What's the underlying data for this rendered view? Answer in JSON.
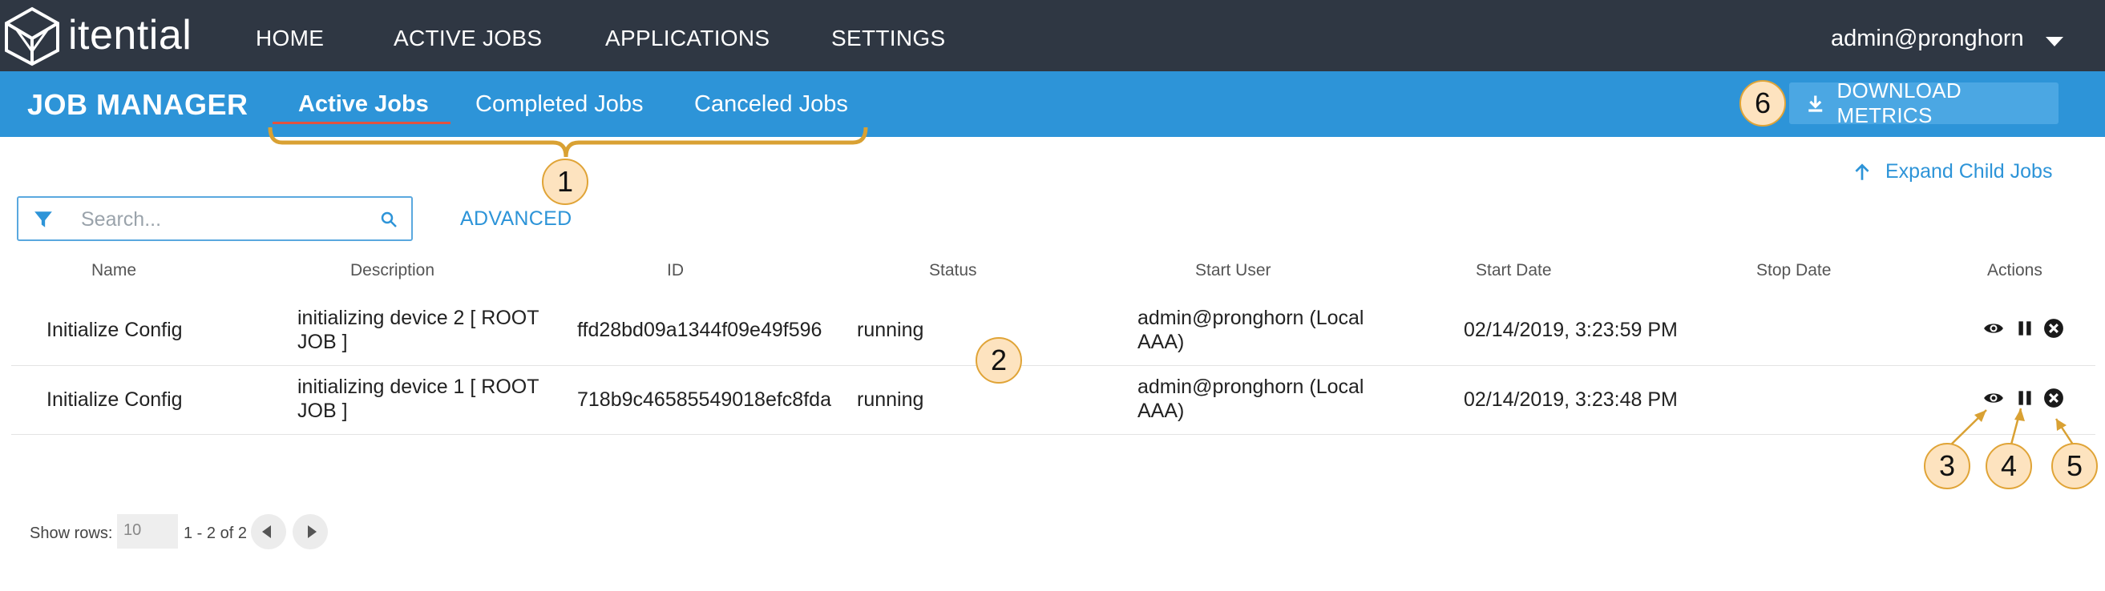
{
  "topbar": {
    "brand": "itential",
    "nav": [
      "HOME",
      "ACTIVE JOBS",
      "APPLICATIONS",
      "SETTINGS"
    ],
    "user": "admin@pronghorn"
  },
  "subbar": {
    "title": "JOB MANAGER",
    "tabs": [
      "Active Jobs",
      "Completed Jobs",
      "Canceled Jobs"
    ],
    "active_tab": "Active Jobs",
    "download_label": "DOWNLOAD METRICS"
  },
  "toolbar": {
    "expand_label": "Expand Child Jobs",
    "search_placeholder": "Search...",
    "advanced_label": "ADVANCED"
  },
  "table": {
    "headers": [
      "Name",
      "Description",
      "ID",
      "Status",
      "Start User",
      "Start Date",
      "Stop Date",
      "Actions"
    ],
    "rows": [
      {
        "name": "Initialize Config",
        "desc_line1": "initializing device 2 [ ROOT",
        "desc_line2": "JOB ]",
        "id": "ffd28bd09a1344f09e49f596",
        "status": "running",
        "user_line1": "admin@pronghorn (Local",
        "user_line2": "AAA)",
        "start_date": "02/14/2019, 3:23:59 PM",
        "stop_date": ""
      },
      {
        "name": "Initialize Config",
        "desc_line1": "initializing device 1 [ ROOT",
        "desc_line2": "JOB ]",
        "id": "718b9c46585549018efc8fda",
        "status": "running",
        "user_line1": "admin@pronghorn (Local",
        "user_line2": "AAA)",
        "start_date": "02/14/2019, 3:23:48 PM",
        "stop_date": ""
      }
    ]
  },
  "pagination": {
    "show_rows_label": "Show rows:",
    "rows_value": "10",
    "range": "1 - 2 of 2"
  },
  "callouts": [
    "1",
    "2",
    "3",
    "4",
    "5",
    "6"
  ],
  "colors": {
    "topbar": "#2f3743",
    "accent": "#2d94d8",
    "tab_underline": "#e2523f",
    "callout_fill": "#fde3bf",
    "callout_stroke": "#e0a437"
  }
}
